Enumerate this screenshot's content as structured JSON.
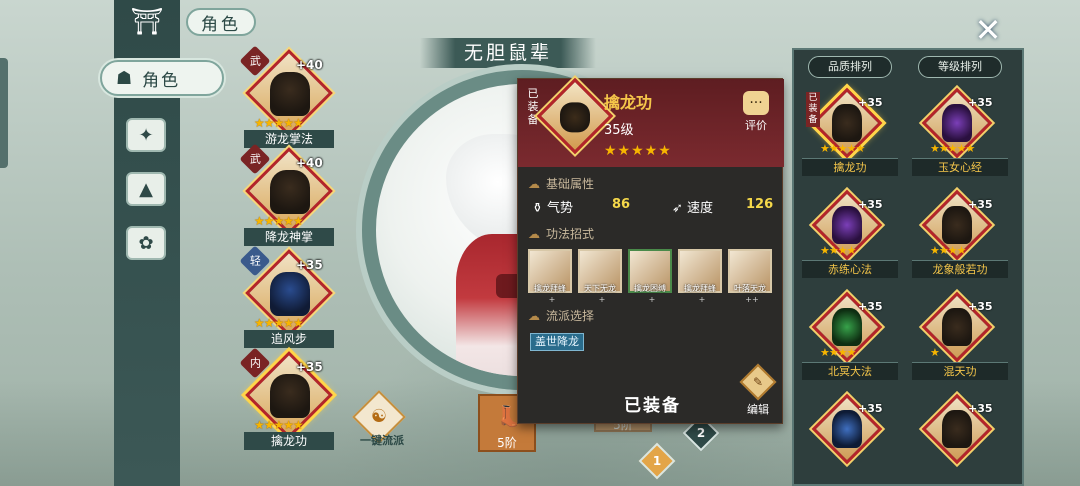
{
  "header": {
    "section_title": "角色",
    "character_name": "无胆鼠辈",
    "close_icon": "close-icon"
  },
  "sidebar": {
    "logo_icon": "pavilion-icon",
    "active_tab": {
      "icon": "hat-icon",
      "label": "角色"
    },
    "items": [
      {
        "icon": "fire-icon"
      },
      {
        "icon": "pagoda-icon"
      },
      {
        "icon": "pet-icon"
      }
    ]
  },
  "skills": [
    {
      "tag": "武",
      "level": "+40",
      "stars": "★★★★★",
      "name": "游龙掌法"
    },
    {
      "tag": "武",
      "level": "+40",
      "stars": "★★★★★",
      "name": "降龙神掌"
    },
    {
      "tag": "轻",
      "level": "+35",
      "stars": "★★★★★",
      "name": "追风步"
    },
    {
      "tag": "内",
      "level": "+35",
      "stars": "★★★★★",
      "name": "擒龙功"
    }
  ],
  "one_click": {
    "label": "一键流派"
  },
  "tier": {
    "label": "5阶"
  },
  "tier_behind": {
    "label": "5阶"
  },
  "badges": {
    "b1": "1",
    "b2": "2"
  },
  "popup": {
    "equipped_tag": "已装备",
    "title": "擒龙功",
    "level": "35级",
    "stars": "★★★★★",
    "review_label": "评价",
    "basic_attr_header": "基础属性",
    "stats": [
      {
        "label": "气势",
        "value": "86"
      },
      {
        "label": "速度",
        "value": "126"
      }
    ],
    "moves_header": "功法招式",
    "moves": [
      {
        "name": "擒龙拜蜂",
        "plus": "+"
      },
      {
        "name": "天下无龙",
        "plus": "+"
      },
      {
        "name": "擒龙困缚",
        "plus": "+"
      },
      {
        "name": "擒龙拜蜂",
        "plus": "+"
      },
      {
        "name": "叶落天龙",
        "plus": "++"
      }
    ],
    "school_header": "流派选择",
    "school_value": "盖世降龙",
    "equip_state": "已装备",
    "edit_label": "编辑"
  },
  "right_panel": {
    "sort_quality": "品质排列",
    "sort_level": "等级排列",
    "items": [
      {
        "name": "擒龙功",
        "level": "+35",
        "stars": "★★★★★",
        "equipped": "已装备"
      },
      {
        "name": "玉女心经",
        "level": "+35",
        "stars": "★★★★★"
      },
      {
        "name": "赤练心法",
        "level": "+35",
        "stars": "★★★★"
      },
      {
        "name": "龙象般若功",
        "level": "+35",
        "stars": "★★★★"
      },
      {
        "name": "北冥大法",
        "level": "+35",
        "stars": "★★★★"
      },
      {
        "name": "混天功",
        "level": "+35",
        "stars": "★"
      },
      {
        "name": "",
        "level": "+35",
        "stars": ""
      },
      {
        "name": "",
        "level": "+35",
        "stars": ""
      }
    ]
  }
}
